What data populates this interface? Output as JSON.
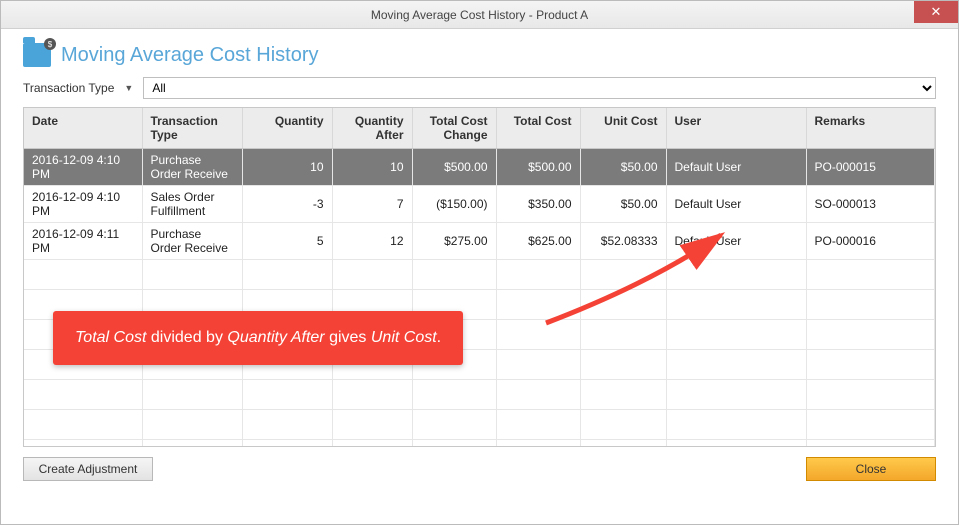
{
  "window": {
    "title": "Moving Average Cost History - Product A"
  },
  "header": {
    "title": "Moving Average Cost History",
    "icon_badge": "$"
  },
  "filter": {
    "label": "Transaction Type",
    "value": "All"
  },
  "columns": {
    "date": "Date",
    "type": "Transaction Type",
    "qty": "Quantity",
    "qty_after": "Quantity After",
    "cost_change": "Total Cost Change",
    "total_cost": "Total Cost",
    "unit_cost": "Unit Cost",
    "user": "User",
    "remarks": "Remarks"
  },
  "rows": [
    {
      "date": "2016-12-09 4:10 PM",
      "type": "Purchase Order Receive",
      "qty": "10",
      "qty_after": "10",
      "cost_change": "$500.00",
      "total_cost": "$500.00",
      "unit_cost": "$50.00",
      "user": "Default User",
      "remarks": "PO-000015",
      "selected": true
    },
    {
      "date": "2016-12-09 4:10 PM",
      "type": "Sales Order Fulfillment",
      "qty": "-3",
      "qty_after": "7",
      "cost_change": "($150.00)",
      "total_cost": "$350.00",
      "unit_cost": "$50.00",
      "user": "Default User",
      "remarks": "SO-000013",
      "selected": false
    },
    {
      "date": "2016-12-09 4:11 PM",
      "type": "Purchase Order Receive",
      "qty": "5",
      "qty_after": "12",
      "cost_change": "$275.00",
      "total_cost": "$625.00",
      "unit_cost": "$52.08333",
      "user": "Default User",
      "remarks": "PO-000016",
      "selected": false
    }
  ],
  "empty_rows": 7,
  "buttons": {
    "create_adjustment": "Create Adjustment",
    "close": "Close"
  },
  "callout": {
    "parts": [
      {
        "text": "Total Cost",
        "italic": true
      },
      {
        "text": " divided by ",
        "italic": false
      },
      {
        "text": "Quantity After",
        "italic": true
      },
      {
        "text": " gives ",
        "italic": false
      },
      {
        "text": "Unit Cost",
        "italic": true
      },
      {
        "text": ".",
        "italic": false
      }
    ]
  },
  "colors": {
    "accent": "#59a6d8",
    "callout": "#f44336",
    "primary_btn": "#f4a72b"
  }
}
